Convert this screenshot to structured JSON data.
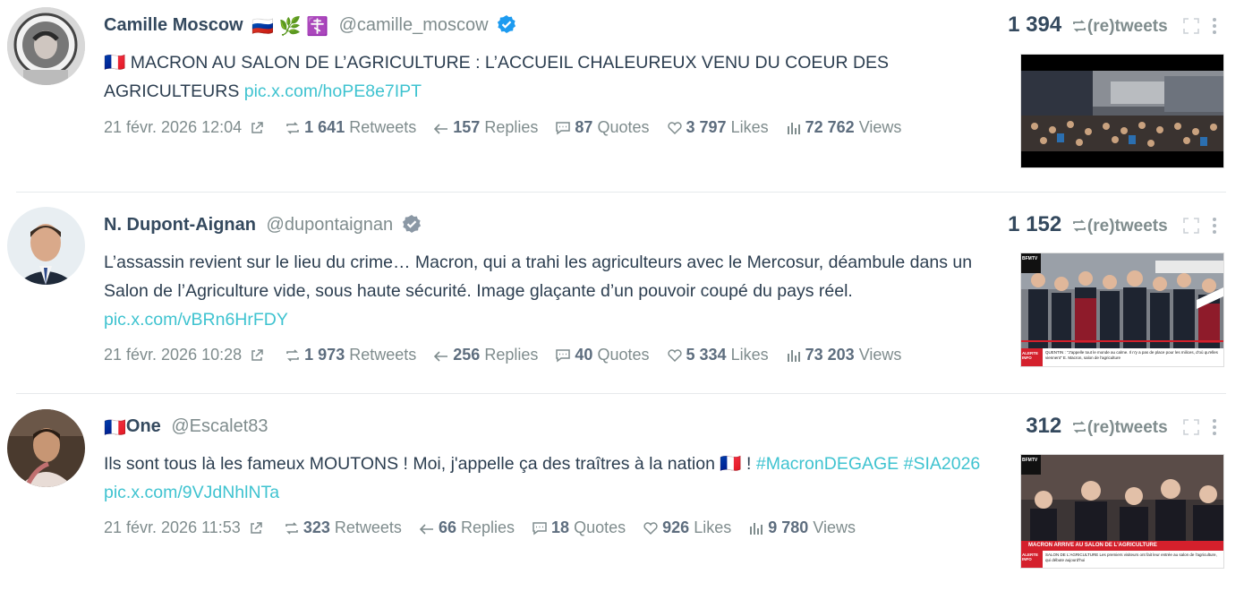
{
  "tweets": [
    {
      "name": "Camille Moscow",
      "flags": "🇷🇺 🌿 ☦️",
      "handle": "@camille_moscow",
      "verified": "blue",
      "text": "🇫🇷 MACRON AU SALON DE L’AGRICULTURE : L’ACCUEIL CHALEUREUX VENU DU COEUR DES AGRICULTEURS",
      "link": "pic.x.com/hoPE8e7IPT",
      "date": "21 févr. 2026 12:04",
      "retweets_count": "1 641",
      "retweets_label": "Retweets",
      "replies_count": "157",
      "replies_label": "Replies",
      "quotes_count": "87",
      "quotes_label": "Quotes",
      "likes_count": "3 797",
      "likes_label": "Likes",
      "views_count": "72 762",
      "views_label": "Views",
      "rt_total": "1 394",
      "rt_label": "(re)tweets"
    },
    {
      "name": "N. Dupont-Aignan",
      "flags": "",
      "handle": "@dupontaignan",
      "verified": "gray",
      "text": "L’assassin revient sur le lieu du crime… Macron, qui a trahi les agriculteurs avec le Mercosur, déambule dans un Salon de l’Agriculture vide, sous haute sécurité. Image glaçante d’un pouvoir coupé du pays réel.",
      "link": "pic.x.com/vBRn6HrFDY",
      "date": "21 févr. 2026 10:28",
      "retweets_count": "1 973",
      "retweets_label": "Retweets",
      "replies_count": "256",
      "replies_label": "Replies",
      "quotes_count": "40",
      "quotes_label": "Quotes",
      "likes_count": "5 334",
      "likes_label": "Likes",
      "views_count": "73 203",
      "views_label": "Views",
      "rt_total": "1 152",
      "rt_label": "(re)tweets"
    },
    {
      "name": "One",
      "flags_before": "🇫🇷",
      "handle": "@Escalet83",
      "verified": "none",
      "text": "Ils sont tous là les fameux MOUTONS ! Moi, j'appelle ça des traîtres à la nation 🇫🇷 !",
      "hashtag1": "#MacronDEGAGE",
      "hashtag2": "#SIA2026",
      "link": "pic.x.com/9VJdNhlNTa",
      "date": "21 févr. 2026 11:53",
      "retweets_count": "323",
      "retweets_label": "Retweets",
      "replies_count": "66",
      "replies_label": "Replies",
      "quotes_count": "18",
      "quotes_label": "Quotes",
      "likes_count": "926",
      "likes_label": "Likes",
      "views_count": "9 780",
      "views_label": "Views",
      "rt_total": "312",
      "rt_label": "(re)tweets"
    }
  ],
  "thumbs": {
    "t2_tag": "BFMTV",
    "t2_banner": "ALERTE INFO",
    "t2_caption": "QUENTIN : \"J'appelle tout le monde au calme. Il n'y a pas de place pour les milices, d'où qu'elles viennent\" E. Macron, salon de l'agriculture",
    "t3_tag": "BFMTV",
    "t3_headline": "MACRON ARRIVE AU SALON DE L'AGRICULTURE",
    "t3_banner": "ALERTE INFO",
    "t3_caption": "SALON DE L'AGRICULTURE Les premiers visiteurs ont fait leur entrée au salon de l'agriculture, qui débute aujourd'hui"
  },
  "colors": {
    "link": "#3fc3d0",
    "verified_blue": "#1d9bf0",
    "verified_gray": "#8b98a5",
    "bfm_red": "#d4202c"
  }
}
